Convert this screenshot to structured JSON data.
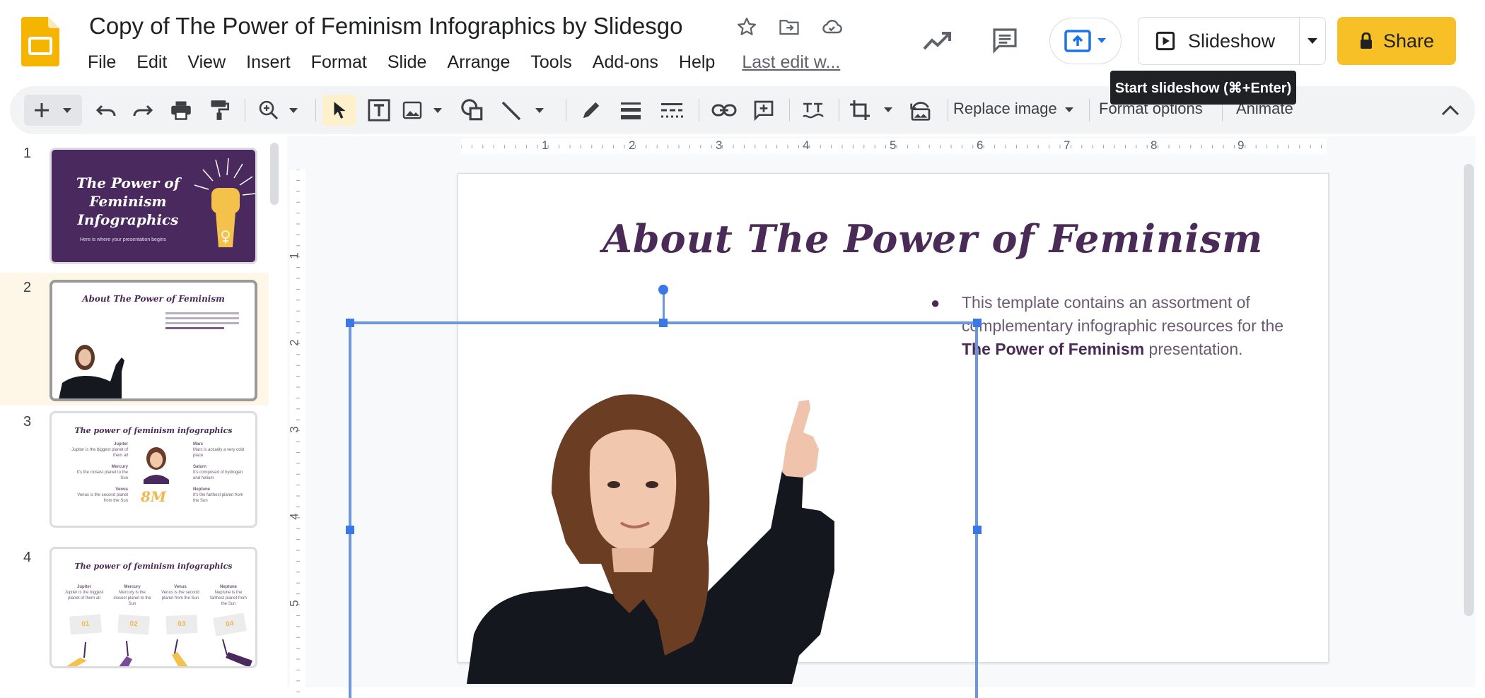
{
  "app": {
    "doc_title": "Copy of The Power of Feminism Infographics by Slidesgo"
  },
  "menu": [
    "File",
    "Edit",
    "View",
    "Insert",
    "Format",
    "Slide",
    "Arrange",
    "Tools",
    "Add-ons",
    "Help"
  ],
  "last_edit": "Last edit w...",
  "header_actions": {
    "slideshow_label": "Slideshow",
    "share_label": "Share",
    "tooltip": "Start slideshow (⌘+Enter)"
  },
  "toolbar": {
    "replace_image": "Replace image",
    "format_options": "Format options",
    "animate": "Animate"
  },
  "ruler": {
    "h": [
      "1",
      "2",
      "3",
      "4",
      "5",
      "6",
      "7",
      "8",
      "9"
    ],
    "v": [
      "1",
      "2",
      "3",
      "4",
      "5"
    ]
  },
  "filmstrip": {
    "numbers": [
      "1",
      "2",
      "3",
      "4"
    ],
    "slide1": {
      "title_lines": [
        "The Power of",
        "Feminism",
        "Infographics"
      ],
      "subtitle": "Here is where your presentation begins"
    },
    "slide2": {
      "title": "About The Power of Feminism"
    },
    "slide3": {
      "title": "The power of feminism infographics",
      "center": "8M",
      "items": [
        {
          "name": "Jupiter",
          "text": "Jupiter is the biggest planet of them all"
        },
        {
          "name": "Mars",
          "text": "Mars is actually a very cold place"
        },
        {
          "name": "Mercury",
          "text": "It's the closest planet to the Sun"
        },
        {
          "name": "Saturn",
          "text": "It's composed of hydrogen and helium"
        },
        {
          "name": "Venus",
          "text": "Venus is the second planet from the Sun"
        },
        {
          "name": "Neptune",
          "text": "It's the farthest planet from the Sun"
        }
      ]
    },
    "slide4": {
      "title": "The power of feminism infographics",
      "cols": [
        {
          "name": "Jupiter",
          "text": "Jupiter is the biggest planet of them all",
          "sign": "01"
        },
        {
          "name": "Mercury",
          "text": "Mercury is the closest planet to the Sun",
          "sign": "02"
        },
        {
          "name": "Venus",
          "text": "Venus is the second planet from the Sun",
          "sign": "03"
        },
        {
          "name": "Neptune",
          "text": "Neptune is the farthest planet from the Sun",
          "sign": "04"
        }
      ]
    }
  },
  "slide": {
    "title": "About The Power of Feminism",
    "body_prefix": "This template contains an assortment of complementary infographic resources for the ",
    "body_bold": "The Power of Feminism",
    "body_suffix": " presentation."
  },
  "colors": {
    "accent": "#f6c026",
    "brand_purple": "#4a2a56",
    "selection": "#3b78e7"
  }
}
